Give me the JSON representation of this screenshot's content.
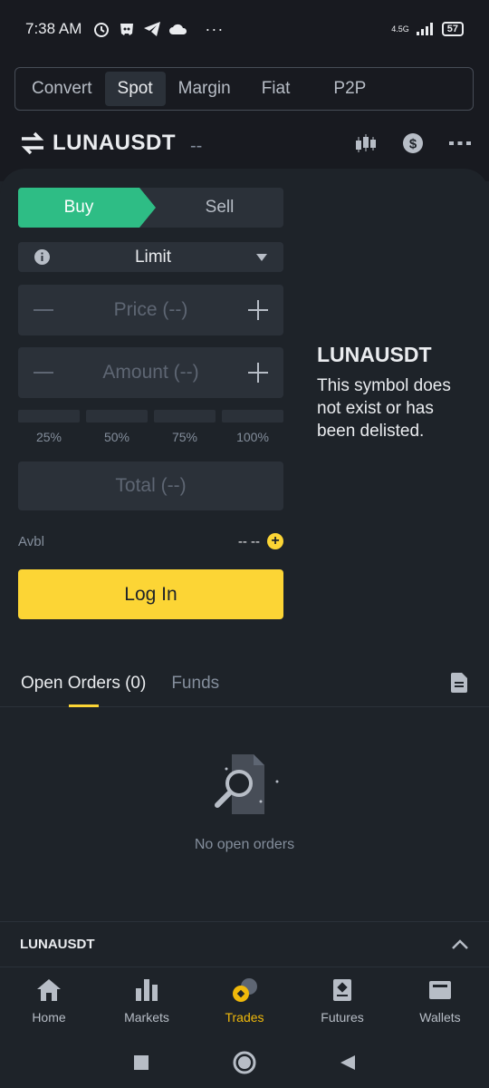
{
  "status_bar": {
    "time": "7:38 AM",
    "extra": "···",
    "network": "4.5G",
    "battery": "57",
    "icons": [
      "alarm-icon",
      "discord-icon",
      "telegram-icon",
      "cloud-icon",
      "signal-icon",
      "battery-icon"
    ]
  },
  "top_tabs": {
    "items": [
      {
        "label": "Convert",
        "active": false
      },
      {
        "label": "Spot",
        "active": true
      },
      {
        "label": "Margin",
        "active": false
      },
      {
        "label": "Fiat",
        "active": false
      },
      {
        "label": "P2P",
        "active": false
      }
    ]
  },
  "pair": {
    "name": "LUNAUSDT",
    "change": "--",
    "actions": [
      "candlestick-chart-icon",
      "dollar-icon",
      "more-icon"
    ]
  },
  "trade_form": {
    "buy_label": "Buy",
    "sell_label": "Sell",
    "order_type": "Limit",
    "price_placeholder": "Price (--)",
    "amount_placeholder": "Amount (--)",
    "percent_options": [
      "25%",
      "50%",
      "75%",
      "100%"
    ],
    "total_placeholder": "Total (--)",
    "avbl_label": "Avbl",
    "avbl_value": "-- --",
    "login_label": "Log In"
  },
  "delisted_notice": {
    "title": "LUNAUSDT",
    "message": "This symbol does not exist or has been delisted."
  },
  "orders": {
    "tabs": [
      {
        "label": "Open Orders (0)",
        "active": true
      },
      {
        "label": "Funds",
        "active": false
      }
    ],
    "empty_text": "No open orders"
  },
  "ticker_bar": {
    "name": "LUNAUSDT"
  },
  "bottom_nav": {
    "items": [
      {
        "label": "Home",
        "icon": "home-icon",
        "active": false
      },
      {
        "label": "Markets",
        "icon": "markets-icon",
        "active": false
      },
      {
        "label": "Trades",
        "icon": "trades-icon",
        "active": true
      },
      {
        "label": "Futures",
        "icon": "futures-icon",
        "active": false
      },
      {
        "label": "Wallets",
        "icon": "wallet-icon",
        "active": false
      }
    ]
  },
  "colors": {
    "accent_yellow": "#fcd535",
    "buy_green": "#2ebd85",
    "background": "#1e2329",
    "surface": "#2b3139"
  }
}
